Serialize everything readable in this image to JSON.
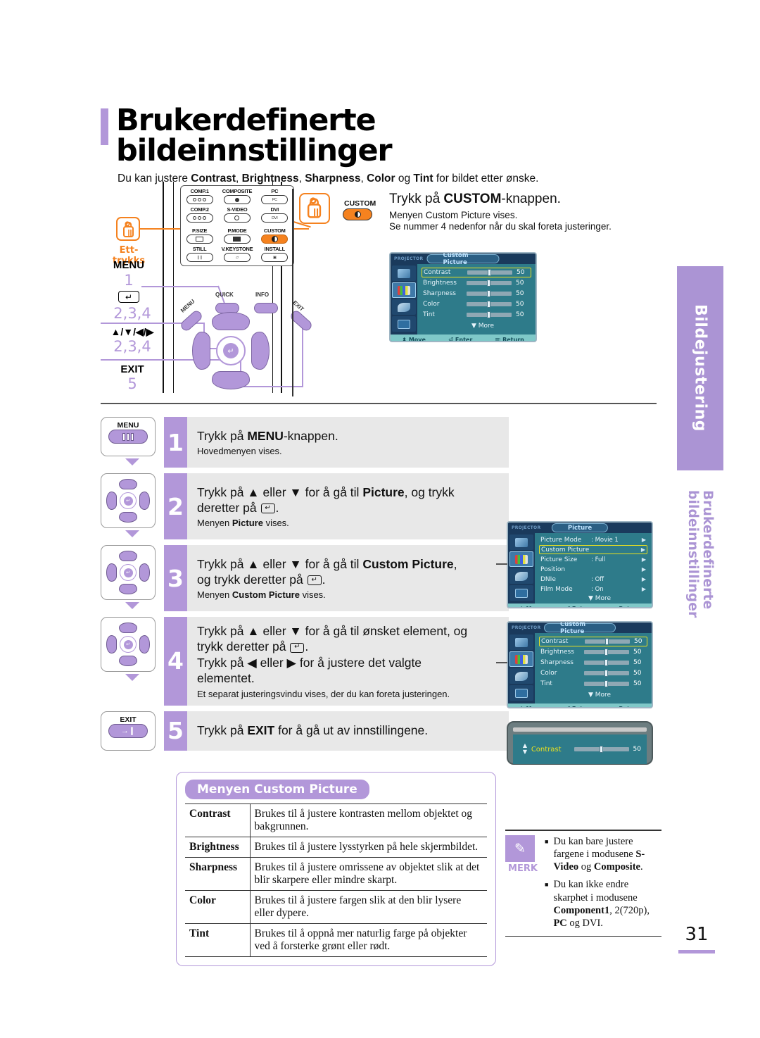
{
  "page": {
    "title": "Brukerdefinerte bildeinnstillinger",
    "subtitle_parts": [
      "Du kan justere ",
      "Contrast",
      ", ",
      "Brightness",
      ", ",
      "Sharpness",
      ", ",
      "Color",
      " og ",
      "Tint",
      " for bildet etter ønske."
    ],
    "number": "31"
  },
  "side_tab": {
    "main": "Bildejustering",
    "sub": "Brukerdefinerte bildeinnstillinger"
  },
  "remote": {
    "one_touch_label": "Ett-trykks",
    "one_touch_icon": "hand-press-icon",
    "keypad": [
      {
        "label": "COMP.1",
        "glyph": "three-dots"
      },
      {
        "label": "COMPOSITE",
        "glyph": "dot"
      },
      {
        "label": "PC",
        "glyph": "PC"
      },
      {
        "label": "COMP.2",
        "glyph": "three-dots"
      },
      {
        "label": "S-VIDEO",
        "glyph": "ring"
      },
      {
        "label": "DVI",
        "glyph": "DVI"
      },
      {
        "label": "P.SIZE",
        "glyph": "screen"
      },
      {
        "label": "P.MODE",
        "glyph": "panel"
      },
      {
        "label": "CUSTOM",
        "glyph": "half-moon"
      },
      {
        "label": "STILL",
        "glyph": "pause"
      },
      {
        "label": "V.KEYSTONE",
        "glyph": "trapezoid"
      },
      {
        "label": "INSTALL",
        "glyph": "install"
      }
    ],
    "callouts": [
      {
        "label": "MENU",
        "steps": "1"
      },
      {
        "label": "↵",
        "steps": "2,3,4"
      },
      {
        "label": "▲/▼/◀/▶",
        "steps": "2,3,4"
      },
      {
        "label": "EXIT",
        "steps": "5"
      }
    ],
    "button_names": {
      "menu": "MENU",
      "quick": "QUICK",
      "info": "INFO",
      "exit": "EXIT"
    }
  },
  "custom_header": {
    "button_label": "CUSTOM",
    "title_pre": "Trykk på ",
    "title_bold": "CUSTOM",
    "title_post": "-knappen.",
    "note1": "Menyen Custom Picture vises.",
    "note2": "Se nummer 4 nedenfor når du skal foreta justeringer."
  },
  "osd_custom_picture": {
    "brand": "PROJECTOR",
    "title": "Custom Picture",
    "rows": [
      {
        "name": "Contrast",
        "value": "50",
        "highlight": true
      },
      {
        "name": "Brightness",
        "value": "50",
        "highlight": false
      },
      {
        "name": "Sharpness",
        "value": "50",
        "highlight": false
      },
      {
        "name": "Color",
        "value": "50",
        "highlight": false
      },
      {
        "name": "Tint",
        "value": "50",
        "highlight": false
      }
    ],
    "more": "▼ More",
    "footer": {
      "move": "Move",
      "enter": "Enter",
      "return": "Return"
    }
  },
  "osd_picture": {
    "brand": "PROJECTOR",
    "title": "Picture",
    "rows": [
      {
        "name": "Picture Mode",
        "value": ": Movie 1",
        "highlight": false
      },
      {
        "name": "Custom Picture",
        "value": "",
        "highlight": true
      },
      {
        "name": "Picture Size",
        "value": ": Full",
        "highlight": false
      },
      {
        "name": "Position",
        "value": "",
        "highlight": false
      },
      {
        "name": "DNIe",
        "value": ": Off",
        "highlight": false
      },
      {
        "name": "Film Mode",
        "value": ": On",
        "highlight": false
      }
    ],
    "more": "▼ More",
    "footer": {
      "move": "Move",
      "enter": "Enter",
      "return": "Return"
    }
  },
  "contrast_popup": {
    "label": "Contrast",
    "value": "50",
    "up": "▲",
    "down": "▼"
  },
  "steps": [
    {
      "num": "1",
      "icon": "menu-button",
      "icon_label": "MENU",
      "main_pre": "Trykk på ",
      "main_bold": "MENU",
      "main_post": "-knappen.",
      "note": "Hovedmenyen vises."
    },
    {
      "num": "2",
      "icon": "direction-pad",
      "main_line1_pre": "Trykk på ▲ eller ▼ for å gå til ",
      "main_line1_bold": "Picture",
      "main_line1_post": ", og trykk",
      "main_line2_pre": "deretter på ",
      "main_line2_key": "↵",
      "main_line2_post": ".",
      "note_pre": "Menyen ",
      "note_bold": "Picture",
      "note_post": " vises."
    },
    {
      "num": "3",
      "icon": "direction-pad",
      "main_line1_pre": "Trykk på ▲ eller ▼ for å gå til ",
      "main_line1_bold": "Custom Picture",
      "main_line1_post": ",",
      "main_line2_pre": "og trykk deretter på ",
      "main_line2_key": "↵",
      "main_line2_post": ".",
      "note_pre": "Menyen ",
      "note_bold": "Custom Picture",
      "note_post": " vises."
    },
    {
      "num": "4",
      "icon": "direction-pad",
      "main_line1": "Trykk på ▲ eller ▼ for å gå til ønsket element, og",
      "main_line2_pre": "trykk deretter på ",
      "main_line2_key": "↵",
      "main_line2_post": ".",
      "main_line3": "Trykk på ◀ eller ▶ for å justere det valgte",
      "main_line4": "elementet.",
      "note": "Et separat justeringsvindu vises, der du kan foreta justeringen."
    },
    {
      "num": "5",
      "icon": "exit-button",
      "icon_label": "EXIT",
      "main_pre": "Trykk på ",
      "main_bold": "EXIT",
      "main_post": " for å gå ut av innstillingene.",
      "note": ""
    }
  ],
  "table": {
    "heading": "Menyen Custom Picture",
    "rows": [
      {
        "term": "Contrast",
        "desc": "Brukes til å justere kontrasten mellom objektet og bakgrunnen."
      },
      {
        "term": "Brightness",
        "desc": "Brukes til å justere lysstyrken på hele skjermbildet."
      },
      {
        "term": "Sharpness",
        "desc": "Brukes til å justere omrissene av objektet slik at det blir skarpere eller mindre skarpt."
      },
      {
        "term": "Color",
        "desc": "Brukes til å justere fargen slik at den blir lysere eller dypere."
      },
      {
        "term": "Tint",
        "desc": "Brukes til å oppnå mer naturlig farge på objekter ved å forsterke grønt eller rødt."
      }
    ]
  },
  "merk": {
    "label": "MERK",
    "icon": "pencil-icon",
    "items": [
      {
        "pre": "Du kan bare justere fargene i modusene ",
        "bold1": "S-Video",
        "mid": " og ",
        "bold2": "Composite",
        "post": "."
      },
      {
        "pre": "Du kan ikke endre skarphet i modusene ",
        "bold1": "Component1",
        "mid": ", 2(720p), ",
        "bold2": "PC",
        "post": " og DVI."
      }
    ]
  },
  "colors": {
    "purple": "#b297d9",
    "purple_light": "#ab94d4",
    "orange": "#f5821f",
    "osd_teal": "#2e7b8a",
    "osd_navy": "#1a3a5c",
    "step_bg": "#e8e8e8",
    "highlight_yellow": "#e8e020"
  }
}
